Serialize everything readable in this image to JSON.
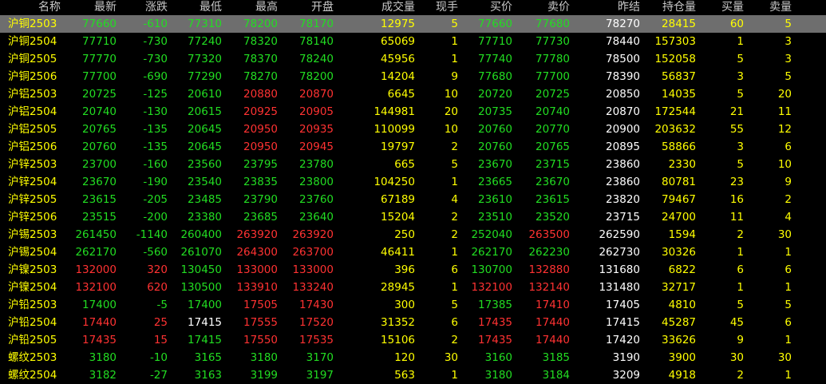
{
  "colors": {
    "background": "#000000",
    "selected_row": "#6e6e6e",
    "up": "#ff3232",
    "down": "#22dd22",
    "flat": "#ffffff",
    "header": "#c8c8c8",
    "name": "#ffff00"
  },
  "headers": [
    "名称",
    "最新",
    "涨跌",
    "最低",
    "最高",
    "开盘",
    "成交量",
    "现手",
    "买价",
    "卖价",
    "昨结",
    "持仓量",
    "买量",
    "卖量"
  ],
  "rows": [
    {
      "name": "沪铜2503",
      "last": "77660",
      "change": "-610",
      "low": "77310",
      "high": "78200",
      "open": "78170",
      "volume": "12975",
      "current": "5",
      "bid": "77660",
      "ask": "77680",
      "prev_settle": "78270",
      "open_interest": "28415",
      "bid_qty": "60",
      "ask_qty": "5"
    },
    {
      "name": "沪铜2504",
      "last": "77710",
      "change": "-730",
      "low": "77240",
      "high": "78320",
      "open": "78140",
      "volume": "65069",
      "current": "1",
      "bid": "77710",
      "ask": "77730",
      "prev_settle": "78440",
      "open_interest": "157303",
      "bid_qty": "1",
      "ask_qty": "3"
    },
    {
      "name": "沪铜2505",
      "last": "77770",
      "change": "-730",
      "low": "77320",
      "high": "78370",
      "open": "78240",
      "volume": "45956",
      "current": "1",
      "bid": "77740",
      "ask": "77780",
      "prev_settle": "78500",
      "open_interest": "152058",
      "bid_qty": "5",
      "ask_qty": "3"
    },
    {
      "name": "沪铜2506",
      "last": "77700",
      "change": "-690",
      "low": "77290",
      "high": "78270",
      "open": "78200",
      "volume": "14204",
      "current": "9",
      "bid": "77680",
      "ask": "77700",
      "prev_settle": "78390",
      "open_interest": "56837",
      "bid_qty": "3",
      "ask_qty": "5"
    },
    {
      "name": "沪铝2503",
      "last": "20725",
      "change": "-125",
      "low": "20610",
      "high": "20880",
      "open": "20870",
      "volume": "6645",
      "current": "10",
      "bid": "20720",
      "ask": "20725",
      "prev_settle": "20850",
      "open_interest": "14035",
      "bid_qty": "5",
      "ask_qty": "20"
    },
    {
      "name": "沪铝2504",
      "last": "20740",
      "change": "-130",
      "low": "20615",
      "high": "20925",
      "open": "20905",
      "volume": "144981",
      "current": "20",
      "bid": "20735",
      "ask": "20740",
      "prev_settle": "20870",
      "open_interest": "172544",
      "bid_qty": "21",
      "ask_qty": "11"
    },
    {
      "name": "沪铝2505",
      "last": "20765",
      "change": "-135",
      "low": "20645",
      "high": "20950",
      "open": "20935",
      "volume": "110099",
      "current": "10",
      "bid": "20760",
      "ask": "20770",
      "prev_settle": "20900",
      "open_interest": "203632",
      "bid_qty": "55",
      "ask_qty": "12"
    },
    {
      "name": "沪铝2506",
      "last": "20760",
      "change": "-135",
      "low": "20645",
      "high": "20950",
      "open": "20945",
      "volume": "19797",
      "current": "2",
      "bid": "20760",
      "ask": "20765",
      "prev_settle": "20895",
      "open_interest": "58866",
      "bid_qty": "3",
      "ask_qty": "6"
    },
    {
      "name": "沪锌2503",
      "last": "23700",
      "change": "-160",
      "low": "23560",
      "high": "23795",
      "open": "23780",
      "volume": "665",
      "current": "5",
      "bid": "23670",
      "ask": "23715",
      "prev_settle": "23860",
      "open_interest": "2330",
      "bid_qty": "5",
      "ask_qty": "10"
    },
    {
      "name": "沪锌2504",
      "last": "23670",
      "change": "-190",
      "low": "23540",
      "high": "23835",
      "open": "23800",
      "volume": "104250",
      "current": "1",
      "bid": "23665",
      "ask": "23670",
      "prev_settle": "23860",
      "open_interest": "80781",
      "bid_qty": "23",
      "ask_qty": "9"
    },
    {
      "name": "沪锌2505",
      "last": "23615",
      "change": "-205",
      "low": "23485",
      "high": "23790",
      "open": "23760",
      "volume": "67189",
      "current": "4",
      "bid": "23610",
      "ask": "23615",
      "prev_settle": "23820",
      "open_interest": "79467",
      "bid_qty": "16",
      "ask_qty": "2"
    },
    {
      "name": "沪锌2506",
      "last": "23515",
      "change": "-200",
      "low": "23380",
      "high": "23685",
      "open": "23640",
      "volume": "15204",
      "current": "2",
      "bid": "23510",
      "ask": "23520",
      "prev_settle": "23715",
      "open_interest": "24700",
      "bid_qty": "11",
      "ask_qty": "4"
    },
    {
      "name": "沪锡2503",
      "last": "261450",
      "change": "-1140",
      "low": "260400",
      "high": "263920",
      "open": "263920",
      "volume": "250",
      "current": "2",
      "bid": "252040",
      "ask": "263500",
      "prev_settle": "262590",
      "open_interest": "1594",
      "bid_qty": "2",
      "ask_qty": "30"
    },
    {
      "name": "沪锡2504",
      "last": "262170",
      "change": "-560",
      "low": "261070",
      "high": "264300",
      "open": "263700",
      "volume": "46411",
      "current": "1",
      "bid": "262170",
      "ask": "262230",
      "prev_settle": "262730",
      "open_interest": "30326",
      "bid_qty": "1",
      "ask_qty": "1"
    },
    {
      "name": "沪镍2503",
      "last": "132000",
      "change": "320",
      "low": "130450",
      "high": "133000",
      "open": "133000",
      "volume": "396",
      "current": "6",
      "bid": "130700",
      "ask": "132880",
      "prev_settle": "131680",
      "open_interest": "6822",
      "bid_qty": "6",
      "ask_qty": "6"
    },
    {
      "name": "沪镍2504",
      "last": "132100",
      "change": "620",
      "low": "130500",
      "high": "133910",
      "open": "133240",
      "volume": "28945",
      "current": "1",
      "bid": "132100",
      "ask": "132140",
      "prev_settle": "131480",
      "open_interest": "32717",
      "bid_qty": "1",
      "ask_qty": "1"
    },
    {
      "name": "沪铅2503",
      "last": "17400",
      "change": "-5",
      "low": "17400",
      "high": "17505",
      "open": "17430",
      "volume": "300",
      "current": "5",
      "bid": "17385",
      "ask": "17410",
      "prev_settle": "17405",
      "open_interest": "4810",
      "bid_qty": "5",
      "ask_qty": "5"
    },
    {
      "name": "沪铅2504",
      "last": "17440",
      "change": "25",
      "low": "17415",
      "high": "17555",
      "open": "17520",
      "volume": "31352",
      "current": "6",
      "bid": "17435",
      "ask": "17440",
      "prev_settle": "17415",
      "open_interest": "45287",
      "bid_qty": "45",
      "ask_qty": "6"
    },
    {
      "name": "沪铅2505",
      "last": "17435",
      "change": "15",
      "low": "17415",
      "high": "17550",
      "open": "17535",
      "volume": "15106",
      "current": "2",
      "bid": "17435",
      "ask": "17440",
      "prev_settle": "17420",
      "open_interest": "33626",
      "bid_qty": "9",
      "ask_qty": "1"
    },
    {
      "name": "螺纹2503",
      "last": "3180",
      "change": "-10",
      "low": "3165",
      "high": "3180",
      "open": "3170",
      "volume": "120",
      "current": "30",
      "bid": "3160",
      "ask": "3185",
      "prev_settle": "3190",
      "open_interest": "3900",
      "bid_qty": "30",
      "ask_qty": "30"
    },
    {
      "name": "螺纹2504",
      "last": "3182",
      "change": "-27",
      "low": "3163",
      "high": "3199",
      "open": "3197",
      "volume": "563",
      "current": "1",
      "bid": "3180",
      "ask": "3184",
      "prev_settle": "3209",
      "open_interest": "4918",
      "bid_qty": "2",
      "ask_qty": "1"
    }
  ]
}
